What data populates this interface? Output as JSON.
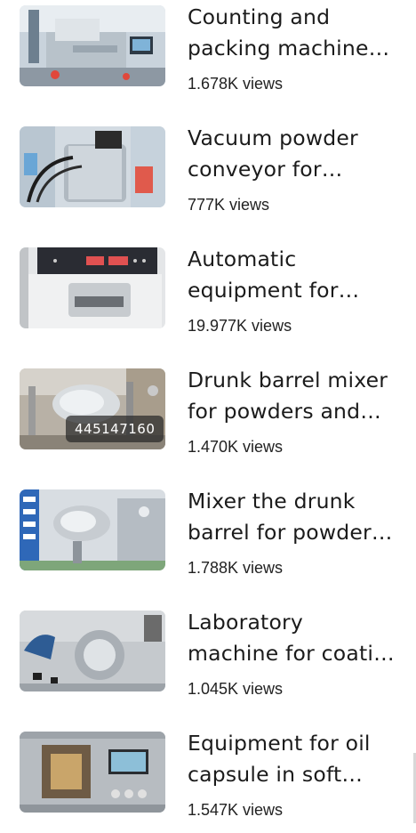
{
  "videos": [
    {
      "title": "Counting and packing machine for tablets and capsules",
      "views": "1.678K views",
      "badge": "",
      "thumb_icon": "counting-machine-thumbnail"
    },
    {
      "title": "Vacuum powder conveyor for pharmaceutical plants",
      "views": "777K views",
      "badge": "",
      "thumb_icon": "vacuum-conveyor-thumbnail"
    },
    {
      "title": "Automatic equipment for testing tablet hardness",
      "views": "19.977K views",
      "badge": "",
      "thumb_icon": "tablet-tester-thumbnail"
    },
    {
      "title": "Drunk barrel mixer for powders and granules",
      "views": "1.470K views",
      "badge": "445147160",
      "thumb_icon": "barrel-mixer-thumbnail"
    },
    {
      "title": "Mixer the drunk barrel for powders and granules",
      "views": "1.788K views",
      "badge": "",
      "thumb_icon": "drum-mixer-thumbnail"
    },
    {
      "title": "Laboratory machine for coating tablets",
      "views": "1.045K views",
      "badge": "",
      "thumb_icon": "coating-machine-thumbnail"
    },
    {
      "title": "Equipment for oil capsule in soft gelatin",
      "views": "1.547K views",
      "badge": "",
      "thumb_icon": "softgel-machine-thumbnail"
    }
  ]
}
